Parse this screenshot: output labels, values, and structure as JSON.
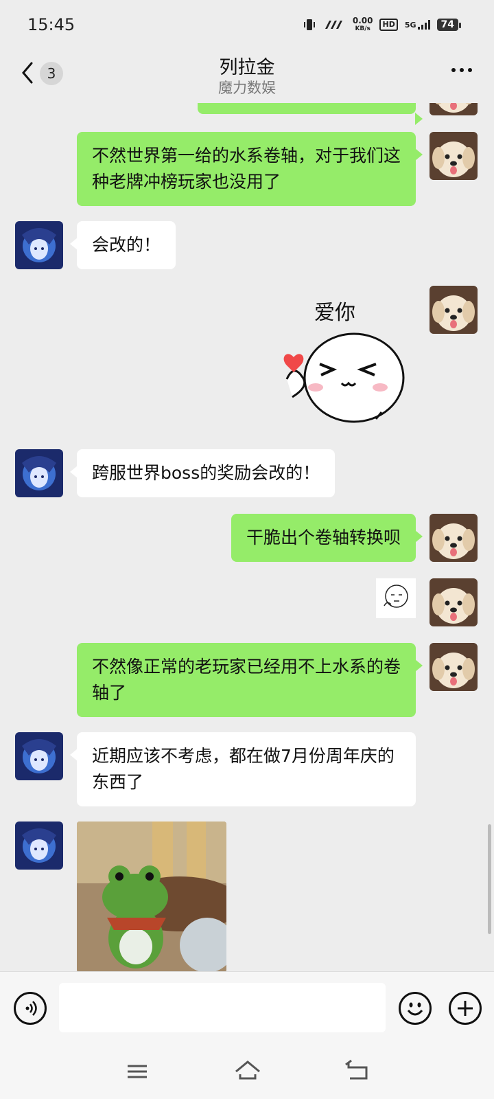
{
  "status_bar": {
    "time": "15:45",
    "net_speed_value": "0.00",
    "net_speed_unit": "KB/s",
    "hd_label": "HD",
    "network": "5G",
    "battery": "74"
  },
  "header": {
    "back_icon": "chevron-left-icon",
    "unread_count": "3",
    "title": "列拉金",
    "subtitle": "魔力数娱",
    "more_icon": "more-icon"
  },
  "messages": [
    {
      "side": "me",
      "type": "text",
      "text": ""
    },
    {
      "side": "me",
      "type": "text",
      "text": "不然世界第一给的水系卷轴，对于我们这种老牌冲榜玩家也没用了"
    },
    {
      "side": "them",
      "type": "text",
      "text": "会改的！"
    },
    {
      "side": "me",
      "type": "sticker",
      "sticker_text": "爱你"
    },
    {
      "side": "them",
      "type": "text",
      "text": "跨服世界boss的奖励会改的！"
    },
    {
      "side": "me",
      "type": "text",
      "text": "干脆出个卷轴转换呗"
    },
    {
      "side": "me",
      "type": "sticker",
      "sticker_text": ""
    },
    {
      "side": "me",
      "type": "text",
      "text": "不然像正常的老玩家已经用不上水系的卷轴了"
    },
    {
      "side": "them",
      "type": "text",
      "text": "近期应该不考虑，都在做7月份周年庆的东西了"
    },
    {
      "side": "them",
      "type": "image",
      "image_desc": "green frog plush"
    }
  ],
  "input_bar": {
    "voice_icon": "voice-icon",
    "emoji_icon": "emoji-icon",
    "plus_icon": "plus-icon"
  },
  "system_nav": {
    "menu_icon": "menu-icon",
    "home_icon": "home-icon",
    "back_icon": "back-icon"
  },
  "colors": {
    "background": "#ededed",
    "my_bubble": "#95ec69",
    "their_bubble": "#ffffff"
  }
}
